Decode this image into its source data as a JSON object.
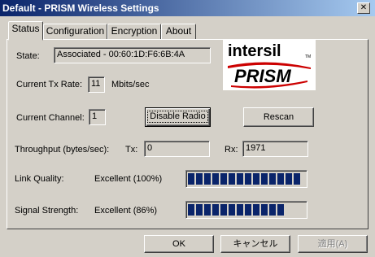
{
  "window": {
    "title": "Default - PRISM Wireless Settings",
    "close_glyph": "✕"
  },
  "tabs": [
    {
      "label": "Status",
      "active": true
    },
    {
      "label": "Configuration",
      "active": false
    },
    {
      "label": "Encryption",
      "active": false
    },
    {
      "label": "About",
      "active": false
    }
  ],
  "logo": {
    "brand": "intersil",
    "product": "PRISM",
    "mark": "TM"
  },
  "status": {
    "state_label": "State:",
    "state_value": "Associated - 00:60:1D:F6:6B:4A",
    "tx_rate_label": "Current Tx Rate:",
    "tx_rate_value": "11",
    "tx_rate_unit": "Mbits/sec",
    "channel_label": "Current Channel:",
    "channel_value": "1",
    "disable_radio_label": "Disable Radio",
    "rescan_label": "Rescan",
    "throughput_label": "Throughput (bytes/sec):",
    "tx_label": "Tx:",
    "tx_value": "0",
    "rx_label": "Rx:",
    "rx_value": "1971",
    "link_quality_label": "Link Quality:",
    "link_quality_value": "Excellent (100%)",
    "link_quality_level": 1.0,
    "signal_strength_label": "Signal Strength:",
    "signal_strength_value": "Excellent (86%)",
    "signal_strength_level": 0.86
  },
  "footer": {
    "ok_label": "OK",
    "cancel_label": "キャンセル",
    "apply_label": "適用(A)"
  },
  "colors": {
    "titlebar_start": "#0a246a",
    "titlebar_end": "#a6caf0",
    "meter_fill": "#0a246a",
    "logo_red": "#cc0000"
  }
}
